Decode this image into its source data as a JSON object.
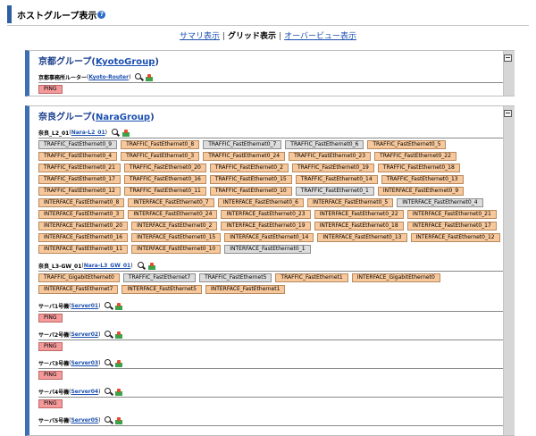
{
  "header": {
    "title": "ホストグループ表示",
    "help_icon": "question-circle-icon"
  },
  "view_tabs": {
    "summary": "サマリ表示",
    "grid": "グリッド表示",
    "overview": "オーバービュー表示",
    "separator": "|"
  },
  "colors": {
    "normal": "#f7c89c",
    "unknown": "#dcdcdc",
    "critical": "#f49a9a",
    "link": "#1a4fb0",
    "panel_accent": "#3d6fb3"
  },
  "groups": [
    {
      "name": "京都グループ",
      "paren_open": "(",
      "id": "KyotoGroup",
      "paren_close": ")",
      "hosts": [
        {
          "name": "京都事務所ルーター",
          "paren_open": "(",
          "id": "Kyoto-Router",
          "paren_close": ")",
          "services": [
            {
              "label": "PING",
              "status": "red"
            }
          ]
        }
      ]
    },
    {
      "name": "奈良グループ",
      "paren_open": "(",
      "id": "NaraGroup",
      "paren_close": ")",
      "hosts": [
        {
          "name": "奈良_L2_01",
          "paren_open": "(",
          "id": "Nara-L2_01",
          "paren_close": ")",
          "services": [
            {
              "label": "TRAFFIC_FastEthernet0_9",
              "status": "grey"
            },
            {
              "label": "TRAFFIC_FastEthernet0_8",
              "status": "orange"
            },
            {
              "label": "TRAFFIC_FastEthernet0_7",
              "status": "grey"
            },
            {
              "label": "TRAFFIC_FastEthernet0_6",
              "status": "grey"
            },
            {
              "label": "TRAFFIC_FastEthernet0_5",
              "status": "orange"
            },
            {
              "label": "TRAFFIC_FastEthernet0_4",
              "status": "orange"
            },
            {
              "label": "TRAFFIC_FastEthernet0_3",
              "status": "orange"
            },
            {
              "label": "TRAFFIC_FastEthernet0_24",
              "status": "orange"
            },
            {
              "label": "TRAFFIC_FastEthernet0_23",
              "status": "orange"
            },
            {
              "label": "TRAFFIC_FastEthernet0_22",
              "status": "orange"
            },
            {
              "label": "TRAFFIC_FastEthernet0_21",
              "status": "orange"
            },
            {
              "label": "TRAFFIC_FastEthernet0_20",
              "status": "orange"
            },
            {
              "label": "TRAFFIC_FastEthernet0_2",
              "status": "orange"
            },
            {
              "label": "TRAFFIC_FastEthernet0_19",
              "status": "orange"
            },
            {
              "label": "TRAFFIC_FastEthernet0_18",
              "status": "orange"
            },
            {
              "label": "TRAFFIC_FastEthernet0_17",
              "status": "orange"
            },
            {
              "label": "TRAFFIC_FastEthernet0_16",
              "status": "orange"
            },
            {
              "label": "TRAFFIC_FastEthernet0_15",
              "status": "orange"
            },
            {
              "label": "TRAFFIC_FastEthernet0_14",
              "status": "orange"
            },
            {
              "label": "TRAFFIC_FastEthernet0_13",
              "status": "orange"
            },
            {
              "label": "TRAFFIC_FastEthernet0_12",
              "status": "orange"
            },
            {
              "label": "TRAFFIC_FastEthernet0_11",
              "status": "orange"
            },
            {
              "label": "TRAFFIC_FastEthernet0_10",
              "status": "orange"
            },
            {
              "label": "TRAFFIC_FastEthernet0_1",
              "status": "grey"
            },
            {
              "label": "INTERFACE_FastEthernet0_9",
              "status": "orange"
            },
            {
              "label": "INTERFACE_FastEthernet0_8",
              "status": "orange"
            },
            {
              "label": "INTERFACE_FastEthernet0_7",
              "status": "orange"
            },
            {
              "label": "INTERFACE_FastEthernet0_6",
              "status": "orange"
            },
            {
              "label": "INTERFACE_FastEthernet0_5",
              "status": "orange"
            },
            {
              "label": "INTERFACE_FastEthernet0_4",
              "status": "grey"
            },
            {
              "label": "INTERFACE_FastEthernet0_3",
              "status": "orange"
            },
            {
              "label": "INTERFACE_FastEthernet0_24",
              "status": "orange"
            },
            {
              "label": "INTERFACE_FastEthernet0_23",
              "status": "orange"
            },
            {
              "label": "INTERFACE_FastEthernet0_22",
              "status": "orange"
            },
            {
              "label": "INTERFACE_FastEthernet0_21",
              "status": "orange"
            },
            {
              "label": "INTERFACE_FastEthernet0_20",
              "status": "orange"
            },
            {
              "label": "INTERFACE_FastEthernet0_2",
              "status": "orange"
            },
            {
              "label": "INTERFACE_FastEthernet0_19",
              "status": "orange"
            },
            {
              "label": "INTERFACE_FastEthernet0_18",
              "status": "orange"
            },
            {
              "label": "INTERFACE_FastEthernet0_17",
              "status": "orange"
            },
            {
              "label": "INTERFACE_FastEthernet0_16",
              "status": "orange"
            },
            {
              "label": "INTERFACE_FastEthernet0_15",
              "status": "orange"
            },
            {
              "label": "INTERFACE_FastEthernet0_14",
              "status": "orange"
            },
            {
              "label": "INTERFACE_FastEthernet0_13",
              "status": "orange"
            },
            {
              "label": "INTERFACE_FastEthernet0_12",
              "status": "orange"
            },
            {
              "label": "INTERFACE_FastEthernet0_11",
              "status": "orange"
            },
            {
              "label": "INTERFACE_FastEthernet0_10",
              "status": "orange"
            },
            {
              "label": "INTERFACE_FastEthernet0_1",
              "status": "grey"
            }
          ]
        },
        {
          "name": "奈良_L3-GW_01",
          "paren_open": "(",
          "id": "Nara-L3_GW_01",
          "paren_close": ")",
          "services": [
            {
              "label": "TRAFFIC_GigabitEthernet0",
              "status": "orange"
            },
            {
              "label": "TRAFFIC_FastEthernet7",
              "status": "grey"
            },
            {
              "label": "TRAFFIC_FastEthernet5",
              "status": "grey"
            },
            {
              "label": "TRAFFIC_FastEthernet1",
              "status": "orange"
            },
            {
              "label": "INTERFACE_GigabitEthernet0",
              "status": "orange"
            },
            {
              "label": "INTERFACE_FastEthernet7",
              "status": "orange"
            },
            {
              "label": "INTERFACE_FastEthernet5",
              "status": "orange"
            },
            {
              "label": "INTERFACE_FastEthernet1",
              "status": "orange"
            }
          ]
        },
        {
          "name": "サーバ1号機",
          "paren_open": "(",
          "id": "Server01",
          "paren_close": ")",
          "services": [
            {
              "label": "PING",
              "status": "red"
            }
          ]
        },
        {
          "name": "サーバ2号機",
          "paren_open": "(",
          "id": "Server02",
          "paren_close": ")",
          "services": [
            {
              "label": "PING",
              "status": "red"
            }
          ]
        },
        {
          "name": "サーバ3号機",
          "paren_open": "(",
          "id": "Server03",
          "paren_close": ")",
          "services": [
            {
              "label": "PING",
              "status": "red"
            }
          ]
        },
        {
          "name": "サーバ4号機",
          "paren_open": "(",
          "id": "Server04",
          "paren_close": ")",
          "services": [
            {
              "label": "PING",
              "status": "red"
            }
          ]
        },
        {
          "name": "サーバ5号機",
          "paren_open": "(",
          "id": "Server05",
          "paren_close": ")",
          "services": []
        }
      ]
    }
  ]
}
